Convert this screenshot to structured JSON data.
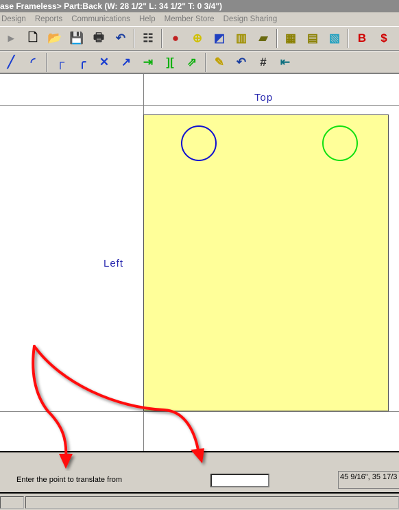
{
  "title": "ase Frameless> Part:Back (W: 28 1/2\" L: 34 1/2\" T: 0 3/4\")",
  "menu": [
    "Design",
    "Reports",
    "Communications",
    "Help",
    "Member Store",
    "Design Sharing"
  ],
  "toolbar1": [
    {
      "icon": "arrow-icon",
      "glyph": "▸",
      "color": "#888"
    },
    {
      "icon": "new-file-icon",
      "glyph": "🗋",
      "color": "#000"
    },
    {
      "icon": "open-folder-icon",
      "glyph": "📂",
      "color": "#8a7a00"
    },
    {
      "icon": "save-icon",
      "glyph": "💾",
      "color": "#333"
    },
    {
      "icon": "print-icon",
      "glyph": "🖶",
      "color": "#333"
    },
    {
      "icon": "undo-icon",
      "glyph": "↶",
      "color": "#1a3ea0"
    },
    {
      "sep": true
    },
    {
      "icon": "settings-icon",
      "glyph": "☷",
      "color": "#333"
    },
    {
      "sep": true
    },
    {
      "icon": "hardware-icon",
      "glyph": "●",
      "color": "#c02020"
    },
    {
      "icon": "bore-icon",
      "glyph": "⊕",
      "color": "#d0c000"
    },
    {
      "icon": "profile-icon",
      "glyph": "◩",
      "color": "#2040c0"
    },
    {
      "icon": "molding-icon",
      "glyph": "▥",
      "color": "#a09000"
    },
    {
      "icon": "drawer-icon",
      "glyph": "▰",
      "color": "#6a6a10"
    },
    {
      "sep": true
    },
    {
      "icon": "cabinet-icon",
      "glyph": "▦",
      "color": "#8a8000"
    },
    {
      "icon": "cabinet-list-icon",
      "glyph": "▤",
      "color": "#8a8000"
    },
    {
      "icon": "room-icon",
      "glyph": "▧",
      "color": "#20a0c0"
    },
    {
      "sep": true
    },
    {
      "icon": "bill-icon",
      "glyph": "B",
      "color": "#d00000"
    },
    {
      "icon": "price-icon",
      "glyph": "$",
      "color": "#d00000"
    }
  ],
  "toolbar2": [
    {
      "icon": "line-icon",
      "glyph": "╱",
      "color": "#1a3ed0"
    },
    {
      "icon": "arc-icon",
      "glyph": "◜",
      "color": "#1a3ed0"
    },
    {
      "sep": true
    },
    {
      "icon": "corner-icon",
      "glyph": "┌",
      "color": "#1a3ed0"
    },
    {
      "icon": "round-corner-icon",
      "glyph": "╭",
      "color": "#1a3ed0"
    },
    {
      "icon": "trim-icon",
      "glyph": "✕",
      "color": "#1a3ed0"
    },
    {
      "icon": "extend-icon",
      "glyph": "↗",
      "color": "#1a3ed0"
    },
    {
      "icon": "move-to-icon",
      "glyph": "⇥",
      "color": "#10b010"
    },
    {
      "icon": "spread-icon",
      "glyph": "][",
      "color": "#10b010"
    },
    {
      "icon": "translate-icon",
      "glyph": "⇗",
      "color": "#10b010"
    },
    {
      "sep": true
    },
    {
      "icon": "eraser-icon",
      "glyph": "✎",
      "color": "#c0a000"
    },
    {
      "icon": "undo-draw-icon",
      "glyph": "↶",
      "color": "#1a3ea0"
    },
    {
      "icon": "grid-icon",
      "glyph": "#",
      "color": "#333"
    },
    {
      "icon": "exit-icon",
      "glyph": "⇤",
      "color": "#107080"
    }
  ],
  "canvas": {
    "top_label": "Top",
    "left_label": "Left",
    "part_color": "#ffff99",
    "circles": [
      {
        "color": "#1010d0"
      },
      {
        "color": "#10e010"
      }
    ]
  },
  "prompt": "Enter the point to translate from",
  "input_value": "",
  "coordinates": "45 9/16\", 35 17/3"
}
